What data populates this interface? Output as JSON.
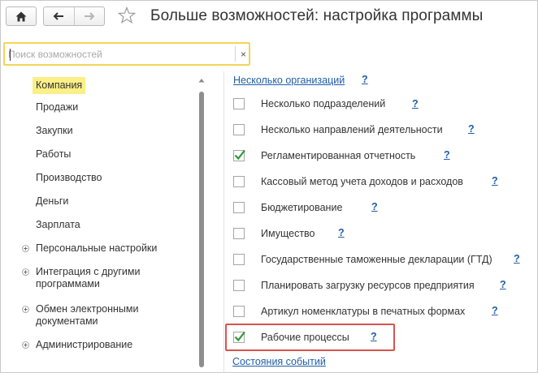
{
  "header": {
    "title": "Больше возможностей: настройка программы"
  },
  "search": {
    "placeholder": "Поиск возможностей",
    "clear_label": "×"
  },
  "sections": [
    {
      "label": "Компания",
      "active": true
    },
    {
      "label": "Продажи"
    },
    {
      "label": "Закупки"
    },
    {
      "label": "Работы"
    },
    {
      "label": "Производство"
    },
    {
      "label": "Деньги"
    },
    {
      "label": "Зарплата"
    },
    {
      "label": "Персональные настройки",
      "expandable": true
    },
    {
      "label": "Интеграция с другими программами",
      "expandable": true
    },
    {
      "label": "Обмен электронными документами",
      "expandable": true
    },
    {
      "label": "Администрирование",
      "expandable": true
    }
  ],
  "options": {
    "top_link": "Несколько организаций",
    "help": "?",
    "items": [
      {
        "label": "Несколько подразделений",
        "checked": false
      },
      {
        "label": "Несколько направлений деятельности",
        "checked": false
      },
      {
        "label": "Регламентированная отчетность",
        "checked": true
      },
      {
        "label": "Кассовый метод учета доходов и расходов",
        "checked": false
      },
      {
        "label": "Бюджетирование",
        "checked": false
      },
      {
        "label": "Имущество",
        "checked": false
      },
      {
        "label": "Государственные таможенные декларации (ГТД)",
        "checked": false
      },
      {
        "label": "Планировать загрузку ресурсов предприятия",
        "checked": false
      },
      {
        "label": "Артикул номенклатуры в печатных формах",
        "checked": false
      },
      {
        "label": "Рабочие процессы",
        "checked": true,
        "highlighted": true
      }
    ],
    "bottom_link": "Состояния событий"
  },
  "colors": {
    "accent_link": "#1f5ea8",
    "active_section": "#fbef87",
    "search_border": "#f2d55a",
    "highlight_border": "#d9534f",
    "check": "#2e9a3a"
  },
  "icons": [
    "home-icon",
    "back-arrow-icon",
    "forward-arrow-icon",
    "star-icon",
    "close-icon",
    "expand-plus-icon",
    "scroll-up-icon",
    "checkmark-icon"
  ]
}
